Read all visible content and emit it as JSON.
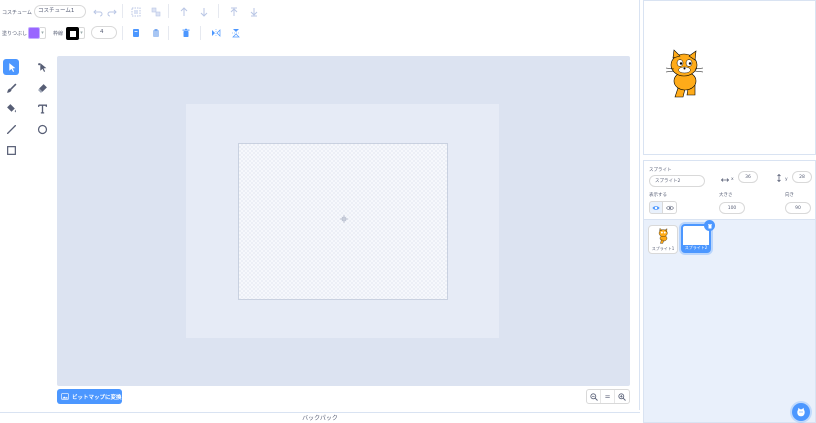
{
  "toolbar": {
    "costume_label": "コスチューム",
    "costume_name": "コスチューム1",
    "fill_label": "塗りつぶし",
    "outline_label": "枠線",
    "outline_width": "4"
  },
  "colors": {
    "fill": "#9966ff",
    "outline": "#000000",
    "accent": "#4c97ff",
    "canvas_bg": "#dce3f1"
  },
  "tools": [
    {
      "name": "select",
      "icon": "arrow-select-icon"
    },
    {
      "name": "reshape",
      "icon": "reshape-icon"
    },
    {
      "name": "brush",
      "icon": "brush-icon"
    },
    {
      "name": "eraser",
      "icon": "eraser-icon"
    },
    {
      "name": "fill",
      "icon": "fill-bucket-icon"
    },
    {
      "name": "text",
      "icon": "text-icon"
    },
    {
      "name": "line",
      "icon": "line-icon"
    },
    {
      "name": "circle",
      "icon": "circle-icon"
    },
    {
      "name": "rectangle",
      "icon": "rectangle-icon"
    }
  ],
  "editor": {
    "convert_button": "ビットマップに変換",
    "zoom_reset": "="
  },
  "backpack_label": "バックパック",
  "sprite_info": {
    "sprite_label": "スプライト",
    "sprite_name": "スプライト2",
    "x_label": "x",
    "x_value": "36",
    "y_label": "y",
    "y_value": "28",
    "show_label": "表示する",
    "size_label": "大きさ",
    "size_value": "100",
    "direction_label": "向き",
    "direction_value": "90"
  },
  "sprites": [
    {
      "name": "スプライト1",
      "selected": false
    },
    {
      "name": "スプライト2",
      "selected": true
    }
  ]
}
